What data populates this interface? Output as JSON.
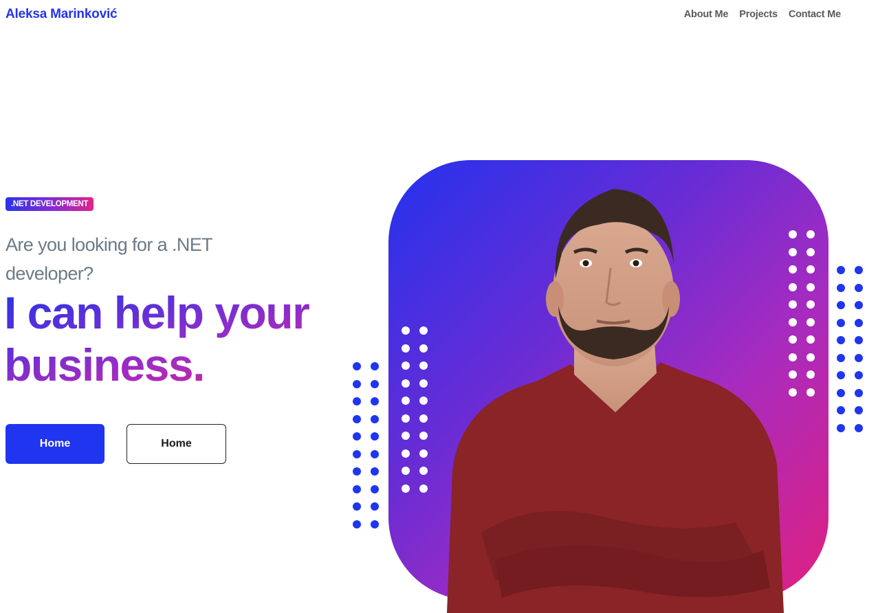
{
  "header": {
    "brand": "Aleksa Marinković",
    "nav": [
      "About Me",
      "Projects",
      "Contact Me"
    ]
  },
  "hero": {
    "badge": ".NET DEVELOPMENT",
    "question": "Are you looking for a .NET developer?",
    "headline": "I can help your business.",
    "buttons": {
      "primary": "Home",
      "secondary": "Home"
    }
  },
  "colors": {
    "brand_blue": "#2534e8",
    "button_blue": "#1f35f0",
    "gradient_start": "#2432ee",
    "gradient_mid": "#8a2bd0",
    "gradient_end": "#e0207f",
    "sweater_red": "#8a2426"
  }
}
